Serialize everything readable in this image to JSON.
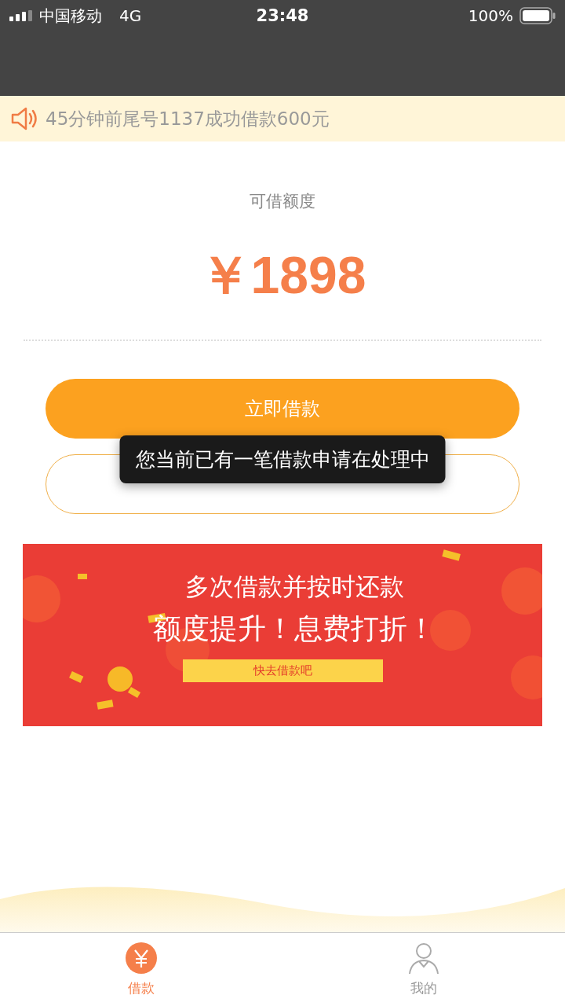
{
  "status_bar": {
    "carrier": "中国移动",
    "network": "4G",
    "time": "23:48",
    "battery": "100%"
  },
  "notice": {
    "text": "45分钟前尾号1137成功借款600元"
  },
  "credit": {
    "label": "可借额度",
    "amount": "￥1898"
  },
  "buttons": [
    {
      "kind": "primary",
      "label": "立即借款"
    },
    {
      "kind": "outline"
    }
  ],
  "toast": {
    "text": "您当前已有一笔借款申请在处理中"
  },
  "banner": {
    "line_1": "多次借款并按时还款",
    "line_2": "额度提升！息费打折！",
    "ribbon": "快去借款吧"
  },
  "tab_bar": [
    {
      "label": "借款",
      "kind": "loan",
      "selected": true
    },
    {
      "label": "我的",
      "kind": "profile",
      "selected": false
    }
  ]
}
